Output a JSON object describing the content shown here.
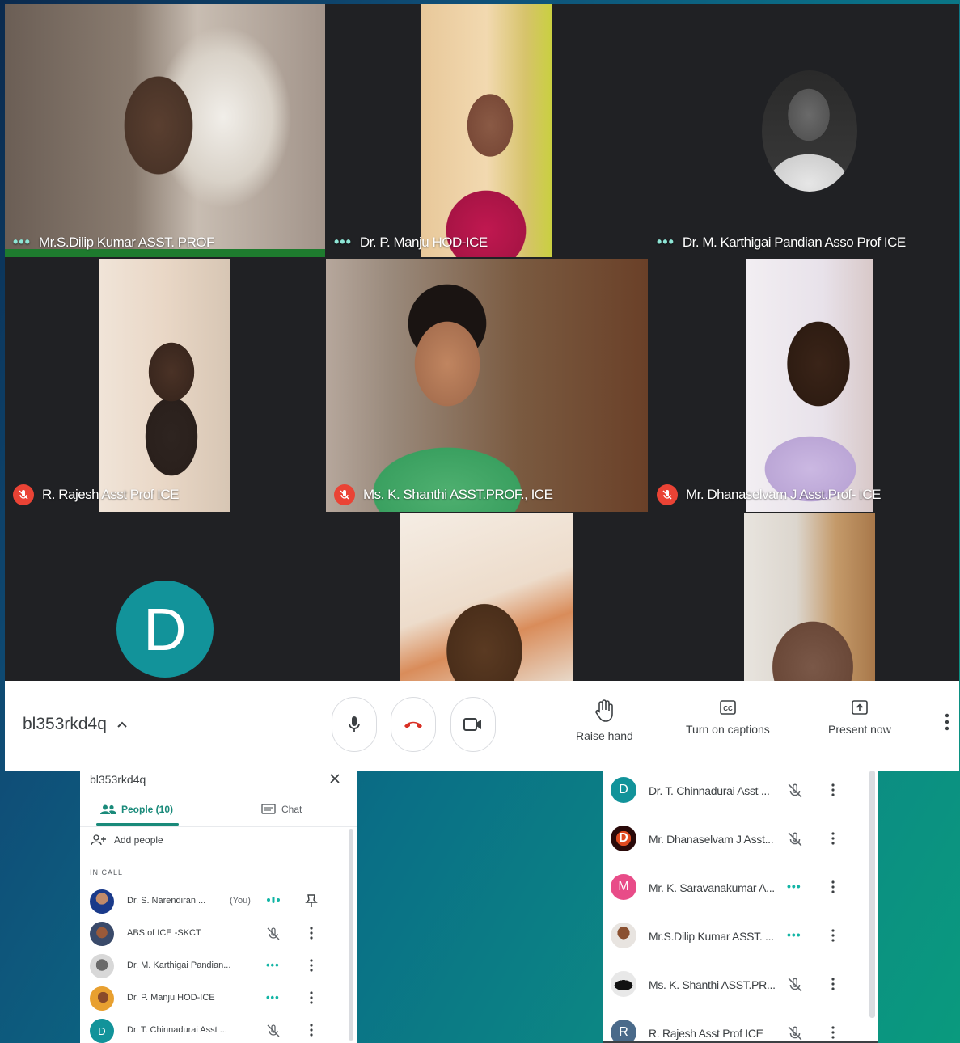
{
  "tiles": [
    {
      "name": "Mr.S.Dilip Kumar ASST. PROF",
      "status": "dots"
    },
    {
      "name": "Dr. P. Manju HOD-ICE",
      "status": "dots"
    },
    {
      "name": "Dr. M. Karthigai Pandian Asso Prof ICE",
      "status": "dots"
    },
    {
      "name": "R. Rajesh Asst Prof ICE",
      "status": "muted"
    },
    {
      "name": "Ms. K. Shanthi ASST.PROF., ICE",
      "status": "muted"
    },
    {
      "name": "Mr. Dhanaselvam J Asst.Prof- ICE",
      "status": "muted"
    },
    {
      "avatar_letter": "D"
    }
  ],
  "toolbar": {
    "meeting_code": "bl353rkd4q",
    "raise_hand": "Raise hand",
    "captions": "Turn on captions",
    "present": "Present now"
  },
  "left_panel": {
    "title": "bl353rkd4q",
    "tab_people": "People (10)",
    "tab_chat": "Chat",
    "add_people": "Add people",
    "section": "IN CALL",
    "participants": [
      {
        "name": "Dr. S. Narendiran ...",
        "you": "(You)",
        "status": "speaking"
      },
      {
        "name": "ABS of ICE -SKCT",
        "status": "muted"
      },
      {
        "name": "Dr. M. Karthigai Pandian...",
        "status": "dots"
      },
      {
        "name": "Dr. P. Manju HOD-ICE",
        "status": "dots"
      },
      {
        "name": "Dr. T. Chinnadurai Asst ...",
        "status": "muted",
        "letter": "D"
      }
    ]
  },
  "right_panel": {
    "participants": [
      {
        "name": "Dr. T. Chinnadurai Asst ...",
        "status": "muted",
        "letter": "D",
        "color": "#12939a"
      },
      {
        "name": "Mr. Dhanaselvam J Asst...",
        "status": "muted",
        "letter": "D",
        "color": "#c0392b"
      },
      {
        "name": "Mr. K. Saravanakumar A...",
        "status": "dots",
        "letter": "M",
        "color": "#e84c88"
      },
      {
        "name": "Mr.S.Dilip Kumar ASST. ...",
        "status": "dots"
      },
      {
        "name": "Ms. K. Shanthi ASST.PR...",
        "status": "muted"
      },
      {
        "name": "R. Rajesh Asst Prof ICE",
        "status": "muted",
        "letter": "R",
        "color": "#4a6a8a"
      }
    ]
  }
}
